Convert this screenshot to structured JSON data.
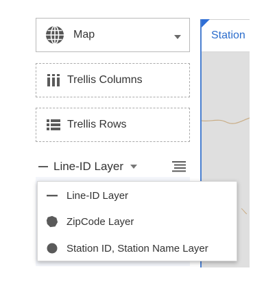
{
  "colors": {
    "accent": "#2a6ccc",
    "canvas_background": "#dfdfdf",
    "icon_gray": "#5a5a5a"
  },
  "shelf": {
    "viz_type": {
      "label": "Map",
      "icon": "globe-icon"
    },
    "drop_zones": [
      {
        "label": "Trellis Columns",
        "icon": "trellis-columns-icon"
      },
      {
        "label": "Trellis Rows",
        "icon": "trellis-rows-icon"
      }
    ],
    "layer_selector": {
      "selected": "Line-ID Layer",
      "icon": "line-icon",
      "menu_icon": "menu-lines-icon"
    }
  },
  "layer_menu": {
    "items": [
      {
        "label": "Line-ID Layer",
        "icon": "line-icon"
      },
      {
        "label": "ZipCode Layer",
        "icon": "polygon-icon"
      },
      {
        "label": "Station ID, Station Name Layer",
        "icon": "point-icon"
      }
    ]
  },
  "canvas": {
    "title": "Station"
  }
}
